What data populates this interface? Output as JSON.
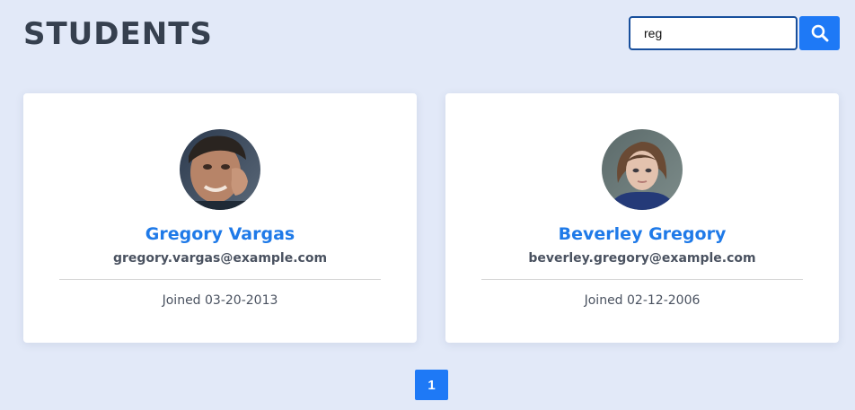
{
  "header": {
    "title": "STUDENTS"
  },
  "search": {
    "value": "reg",
    "button_icon": "search-icon"
  },
  "students": [
    {
      "name": "Gregory Vargas",
      "email": "gregory.vargas@example.com",
      "joined": "Joined 03-20-2013"
    },
    {
      "name": "Beverley Gregory",
      "email": "beverley.gregory@example.com",
      "joined": "Joined 02-12-2006"
    }
  ],
  "pagination": {
    "pages": [
      "1"
    ],
    "current": "1"
  },
  "colors": {
    "background": "#e2e9f8",
    "accent": "#1e79f6",
    "name_text": "#1f7ae8",
    "title_text": "#36404f"
  }
}
